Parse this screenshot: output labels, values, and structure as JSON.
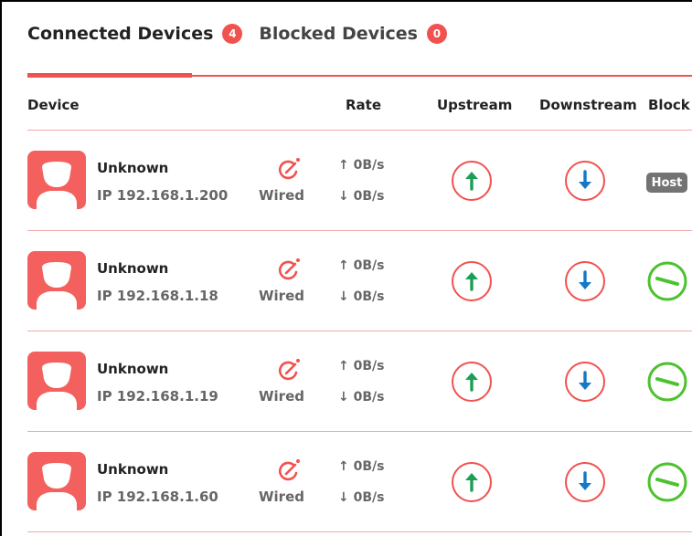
{
  "tabs": {
    "connected": {
      "label": "Connected Devices",
      "count": "4"
    },
    "blocked": {
      "label": "Blocked Devices",
      "count": "0"
    }
  },
  "table": {
    "headers": {
      "device": "Device",
      "rate": "Rate",
      "upstream": "Upstream",
      "downstream": "Downstream",
      "block": "Block"
    },
    "rows": [
      {
        "name": "Unknown",
        "ip": "IP 192.168.1.200",
        "type": "Wired",
        "up_rate": "↑ 0B/s",
        "down_rate": "↓ 0B/s",
        "block": "Host"
      },
      {
        "name": "Unknown",
        "ip": "IP 192.168.1.18",
        "type": "Wired",
        "up_rate": "↑ 0B/s",
        "down_rate": "↓ 0B/s",
        "block": "toggle"
      },
      {
        "name": "Unknown",
        "ip": "IP 192.168.1.19",
        "type": "Wired",
        "up_rate": "↑ 0B/s",
        "down_rate": "↓ 0B/s",
        "block": "toggle"
      },
      {
        "name": "Unknown",
        "ip": "IP 192.168.1.60",
        "type": "Wired",
        "up_rate": "↑ 0B/s",
        "down_rate": "↓ 0B/s",
        "block": "toggle"
      }
    ]
  },
  "icons": {
    "avatar": "user-icon",
    "edit": "edit-icon",
    "upstream": "arrow-up-icon",
    "downstream": "arrow-down-icon",
    "block": "block-toggle-icon"
  },
  "colors": {
    "accent": "#f0524f",
    "arrow_up": "#1c9e55",
    "arrow_down": "#1478c8",
    "block_green": "#4bc22e",
    "host_badge": "#737373"
  }
}
